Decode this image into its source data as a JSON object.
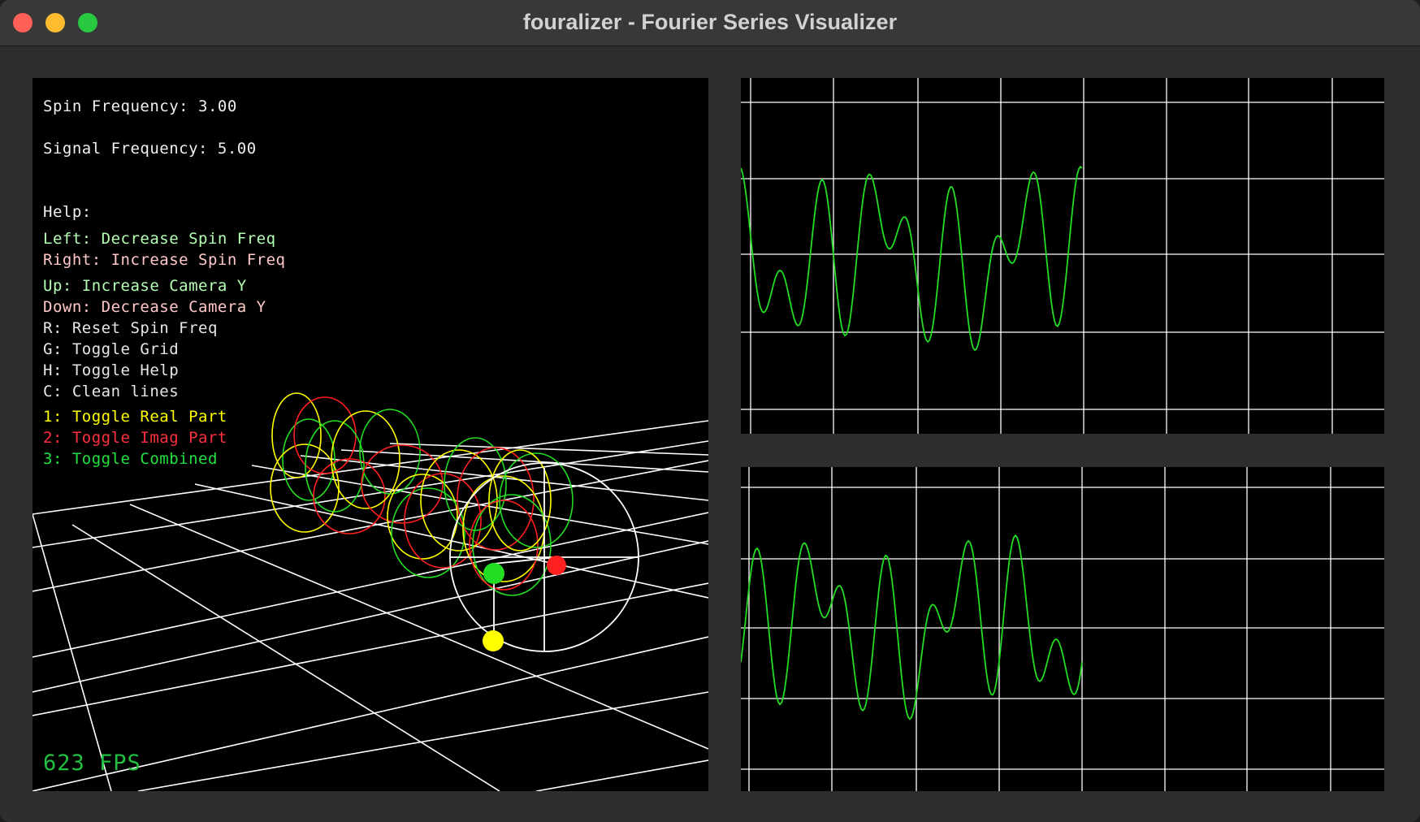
{
  "window": {
    "title": "fouralizer - Fourier Series Visualizer"
  },
  "hud": {
    "spin_frequency": "Spin Frequency: 3.00",
    "signal_frequency": "Signal Frequency: 5.00",
    "help_title": "Help:",
    "help_items": [
      {
        "text": "Left: Decrease Spin Freq",
        "color": "#b4ffb4"
      },
      {
        "text": "Right: Increase Spin Freq",
        "color": "#ffc8c8"
      },
      {
        "text": "Up: Increase Camera Y",
        "color": "#b4ffb4"
      },
      {
        "text": "Down: Decrease Camera Y",
        "color": "#ffc8c8"
      },
      {
        "text": "R: Reset Spin Freq",
        "color": "#e6e6e6"
      },
      {
        "text": "G: Toggle Grid",
        "color": "#e6e6e6"
      },
      {
        "text": "H: Toggle Help",
        "color": "#e6e6e6"
      },
      {
        "text": "C: Clean lines",
        "color": "#e6e6e6"
      },
      {
        "text": "1: Toggle Real Part",
        "color": "#ffff00"
      },
      {
        "text": "2: Toggle Imag Part",
        "color": "#ff3040"
      },
      {
        "text": "3: Toggle Combined",
        "color": "#22e040"
      }
    ],
    "fps": "623 FPS"
  },
  "colors": {
    "real": "#ffff00",
    "imag": "#ff2020",
    "combined": "#22dd22",
    "grid": "#ffffff"
  }
}
